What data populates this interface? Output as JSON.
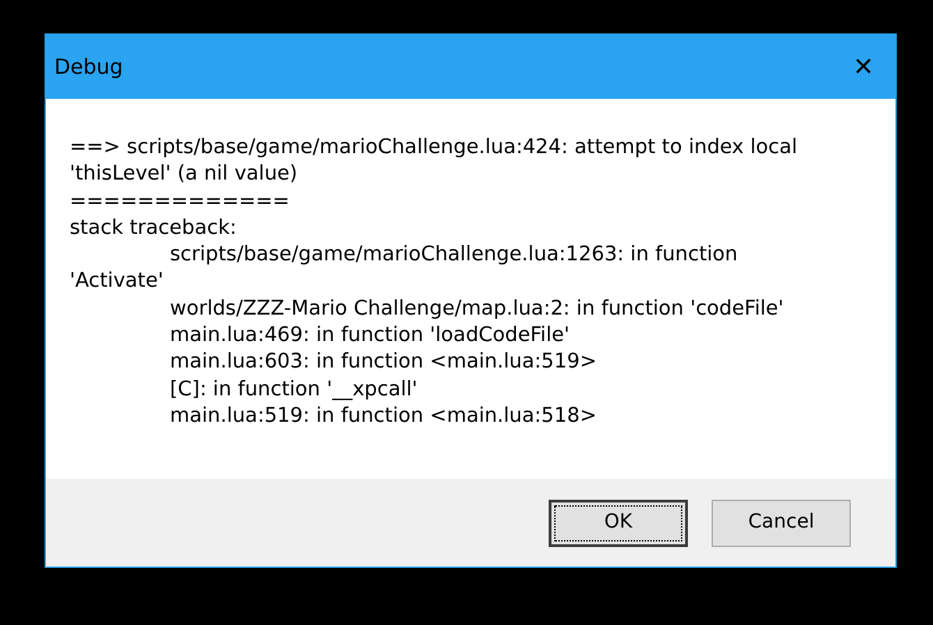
{
  "window": {
    "title": "Debug",
    "close": "✕"
  },
  "message_lines": [
    "==> scripts/base/game/marioChallenge.lua:424: attempt to index local",
    "'thisLevel' (a nil value)",
    "=============",
    "stack traceback:",
    "\tscripts/base/game/marioChallenge.lua:1263: in function",
    "'Activate'",
    "\tworlds/ZZZ-Mario Challenge/map.lua:2: in function 'codeFile'",
    "\tmain.lua:469: in function 'loadCodeFile'",
    "\tmain.lua:603: in function <main.lua:519>",
    "\t[C]: in function '__xpcall'",
    "\tmain.lua:519: in function <main.lua:518>"
  ],
  "buttons": [
    {
      "label": "OK",
      "default": true
    },
    {
      "label": "Cancel",
      "default": false
    }
  ]
}
